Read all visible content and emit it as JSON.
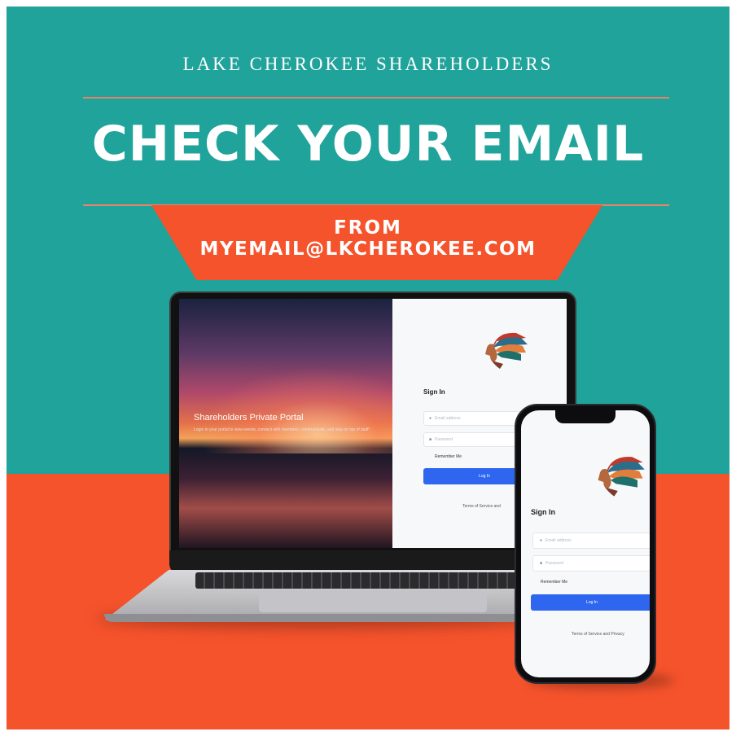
{
  "colors": {
    "teal": "#1fa39a",
    "coral": "#f5532c",
    "button_blue": "#2f66f0"
  },
  "header": {
    "org_name": "LAKE CHEROKEE SHAREHOLDERS",
    "headline": "CHECK YOUR EMAIL",
    "from_label": "FROM",
    "from_email": "MYEMAIL@LKCHEROKEE.COM"
  },
  "laptop": {
    "portal_title": "Shareholders Private Portal",
    "portal_description": "Login to your portal to view events, connect with members, communicate, and stay on top of stuff!",
    "sign_in_title": "Sign In",
    "username_placeholder": "Email address",
    "password_placeholder": "Password",
    "remember_label": "Remember Me",
    "login_button": "Log In",
    "terms_text": "Terms of Service and"
  },
  "phone": {
    "sign_in_title": "Sign In",
    "username_placeholder": "Email address",
    "password_placeholder": "Password",
    "remember_label": "Remember Me",
    "login_button": "Log In",
    "terms_text": "Terms of Service and Privacy"
  },
  "icons": {
    "logo": "native-chief-headdress-logo",
    "user": "user-icon",
    "lock": "lock-icon"
  }
}
